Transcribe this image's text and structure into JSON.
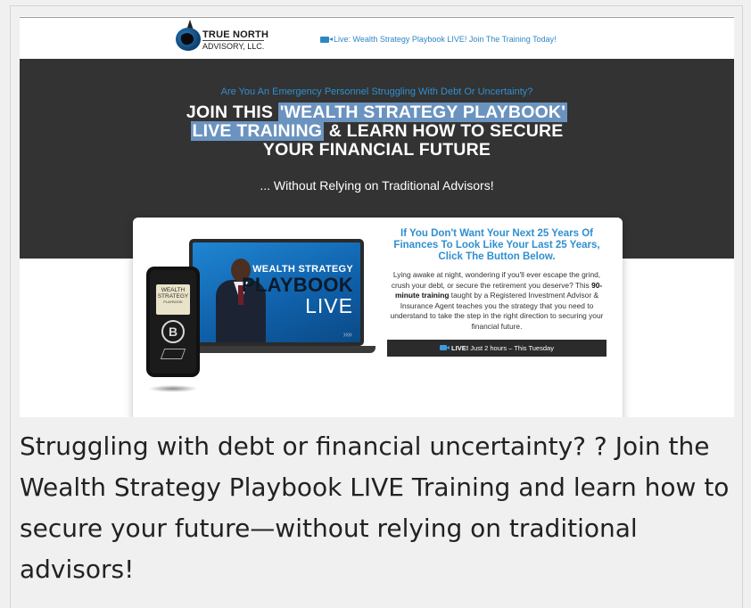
{
  "logo": {
    "line1": "TRUE NORTH",
    "line2": "ADVISORY, LLC."
  },
  "topbar": {
    "live_link": "Live: Wealth Strategy Playbook LIVE! Join The Training Today!",
    "live_icon": "video-camera-icon"
  },
  "hero": {
    "kicker": "Are You An Emergency Personnel Struggling With Debt Or Uncertainty?",
    "headline_pre": "JOIN THIS ",
    "headline_hl1": "'WEALTH STRATEGY PLAYBOOK'",
    "headline_hl2": "LIVE TRAINING",
    "headline_mid": " & LEARN HOW TO SECURE",
    "headline_end": "YOUR FINANCIAL FUTURE",
    "subline": "... Without Relying on Traditional Advisors!",
    "colors": {
      "background": "#333333",
      "accent": "#2f8fd0",
      "highlight": "#6b93bf"
    }
  },
  "product": {
    "laptop_line1": "WEALTH STRATEGY",
    "laptop_line2": "PLAYBOOK",
    "laptop_line3": "LIVE",
    "laptop_chevrons": "››››",
    "phone_line1": "WEALTH",
    "phone_line2": "STRATEGY",
    "phone_line3": "PLAYBOOK",
    "phone_symbol": "B"
  },
  "offer": {
    "title": "If You Don't Want Your Next 25 Years Of Finances To Look Like Your Last 25 Years, Click The Button Below.",
    "body_pre": "Lying awake at night, wondering if you'll ever escape the grind, crush your debt, or secure the retirement you deserve? This ",
    "body_bold": "90-minute training",
    "body_post": " taught by a Registered Investment Advisor & Insurance Agent teaches you the strategy that you need to understand to take the step in the right direction to securing your financial future.",
    "live_bold": "LIVE!",
    "live_rest": " Just 2 hours – This Tuesday"
  },
  "caption": "Struggling with debt or financial uncertainty? ? Join the Wealth Strategy Playbook LIVE Training and learn how to secure your future—without relying on traditional advisors!"
}
